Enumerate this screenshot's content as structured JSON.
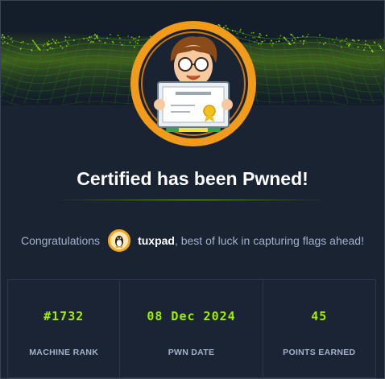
{
  "title": "Certified has been Pwned!",
  "congrats": {
    "prefix": "Congratulations",
    "username": "tuxpad",
    "suffix": ", best of luck in capturing flags ahead!"
  },
  "stats": [
    {
      "value": "#1732",
      "label": "MACHINE RANK"
    },
    {
      "value": "08 Dec 2024",
      "label": "PWN DATE"
    },
    {
      "value": "45",
      "label": "POINTS EARNED"
    }
  ],
  "icons": {
    "banner": "green-digital-grid-background",
    "machine_avatar": "certificate-character-avatar",
    "user_avatar": "tux-penguin-avatar"
  },
  "colors": {
    "background": "#1a2332",
    "accent": "#9fef00",
    "ring": "#f29a1a",
    "text_muted": "#a4b1cd"
  }
}
